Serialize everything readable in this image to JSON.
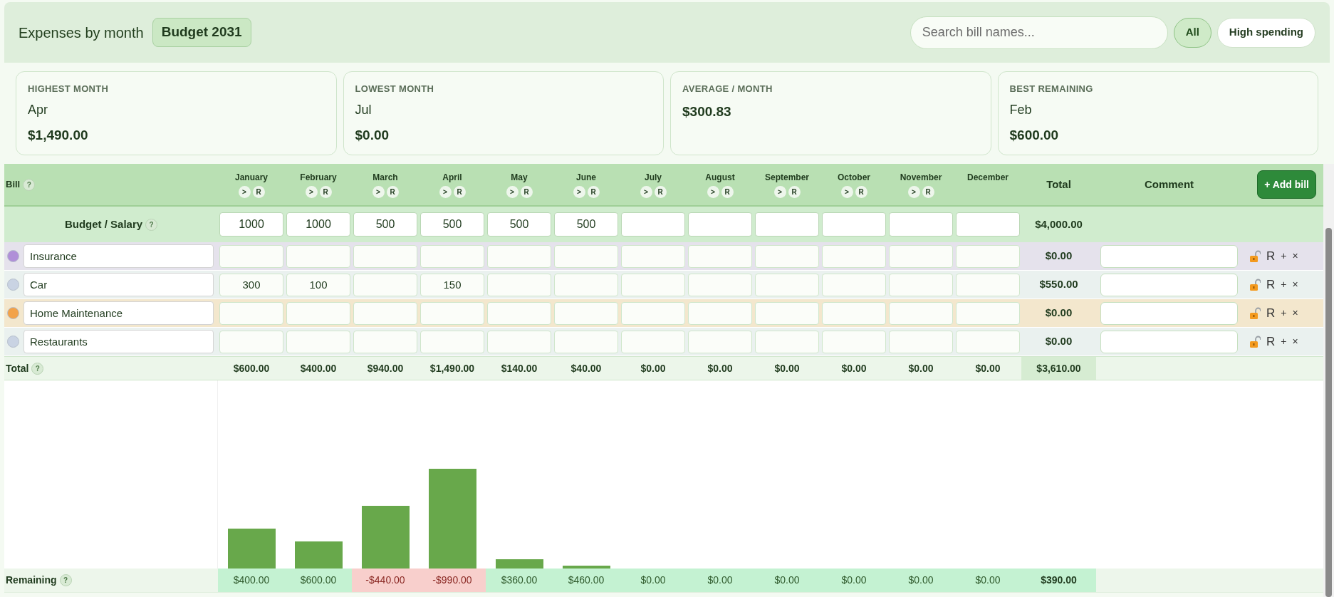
{
  "header": {
    "title": "Expenses by month",
    "badge": "Budget 2031",
    "search": {
      "placeholder": "Search bill names..."
    },
    "filters": [
      {
        "label": "All",
        "selected": true
      },
      {
        "label": "High spending",
        "selected": false
      }
    ]
  },
  "cards": [
    {
      "label": "HIGHEST MONTH",
      "value": "Apr",
      "amount": "$1,490.00"
    },
    {
      "label": "LOWEST MONTH",
      "value": "Jul",
      "amount": "$0.00"
    },
    {
      "label": "AVERAGE / MONTH",
      "amount": "$300.83"
    },
    {
      "label": "BEST REMAINING",
      "value": "Feb",
      "amount": "$600.00"
    }
  ],
  "table": {
    "bill_header": {
      "label": "Bill",
      "help": "?"
    },
    "months": [
      {
        "name": "January",
        "buttons": [
          ">",
          "R"
        ]
      },
      {
        "name": "February",
        "buttons": [
          ">",
          "R"
        ]
      },
      {
        "name": "March",
        "buttons": [
          ">",
          "R"
        ]
      },
      {
        "name": "April",
        "buttons": [
          ">",
          "R"
        ]
      },
      {
        "name": "May",
        "buttons": [
          ">",
          "R"
        ]
      },
      {
        "name": "June",
        "buttons": [
          ">",
          "R"
        ]
      },
      {
        "name": "July",
        "buttons": [
          ">",
          "R"
        ]
      },
      {
        "name": "August",
        "buttons": [
          ">",
          "R"
        ]
      },
      {
        "name": "September",
        "buttons": [
          ">",
          "R"
        ]
      },
      {
        "name": "October",
        "buttons": [
          ">",
          "R"
        ]
      },
      {
        "name": "November",
        "buttons": [
          ">",
          "R"
        ]
      },
      {
        "name": "December"
      }
    ],
    "total_header": "Total",
    "comment_header": "Comment",
    "add_button": "+ Add bill",
    "budget": {
      "label": "Budget / Salary",
      "help": "?",
      "values": {
        "january": "1000",
        "february": "1000",
        "march": "500",
        "april": "500",
        "may": "500",
        "june": "500"
      },
      "total": "$4,000.00"
    },
    "bills": [
      {
        "name": "Insurance",
        "color": "#b08fd8",
        "total": "$0.00",
        "actions": [
          "R",
          "+",
          "×"
        ]
      },
      {
        "name": "Car",
        "color": "#c9d3e3",
        "values": {
          "january": "300",
          "february": "100",
          "april": "150"
        },
        "total": "$550.00",
        "actions": [
          "R",
          "+",
          "×"
        ]
      },
      {
        "name": "Home Maintenance",
        "color": "#f2a24a",
        "total": "$0.00",
        "actions": [
          "R",
          "+",
          "×"
        ]
      },
      {
        "name": "Restaurants",
        "color": "#c9d3e3",
        "total": "$0.00",
        "actions": [
          "R",
          "+",
          "×"
        ]
      }
    ],
    "totals": {
      "label": "Total",
      "help": "?",
      "values": [
        "$600.00",
        "$400.00",
        "$940.00",
        "$1,490.00",
        "$140.00",
        "$40.00",
        "$0.00",
        "$0.00",
        "$0.00",
        "$0.00",
        "$0.00",
        "$0.00"
      ],
      "total": "$3,610.00"
    },
    "remaining": {
      "label": "Remaining",
      "help": "?",
      "cells": [
        {
          "value": "$400.00",
          "negative": false
        },
        {
          "value": "$600.00",
          "negative": false
        },
        {
          "value": "-$440.00",
          "negative": true
        },
        {
          "value": "-$990.00",
          "negative": true
        },
        {
          "value": "$360.00",
          "negative": false
        },
        {
          "value": "$460.00",
          "negative": false
        },
        {
          "value": "$0.00",
          "negative": false
        },
        {
          "value": "$0.00",
          "negative": false
        },
        {
          "value": "$0.00",
          "negative": false
        },
        {
          "value": "$0.00",
          "negative": false
        },
        {
          "value": "$0.00",
          "negative": false
        },
        {
          "value": "$0.00",
          "negative": false
        }
      ],
      "total": "$390.00"
    }
  }
}
